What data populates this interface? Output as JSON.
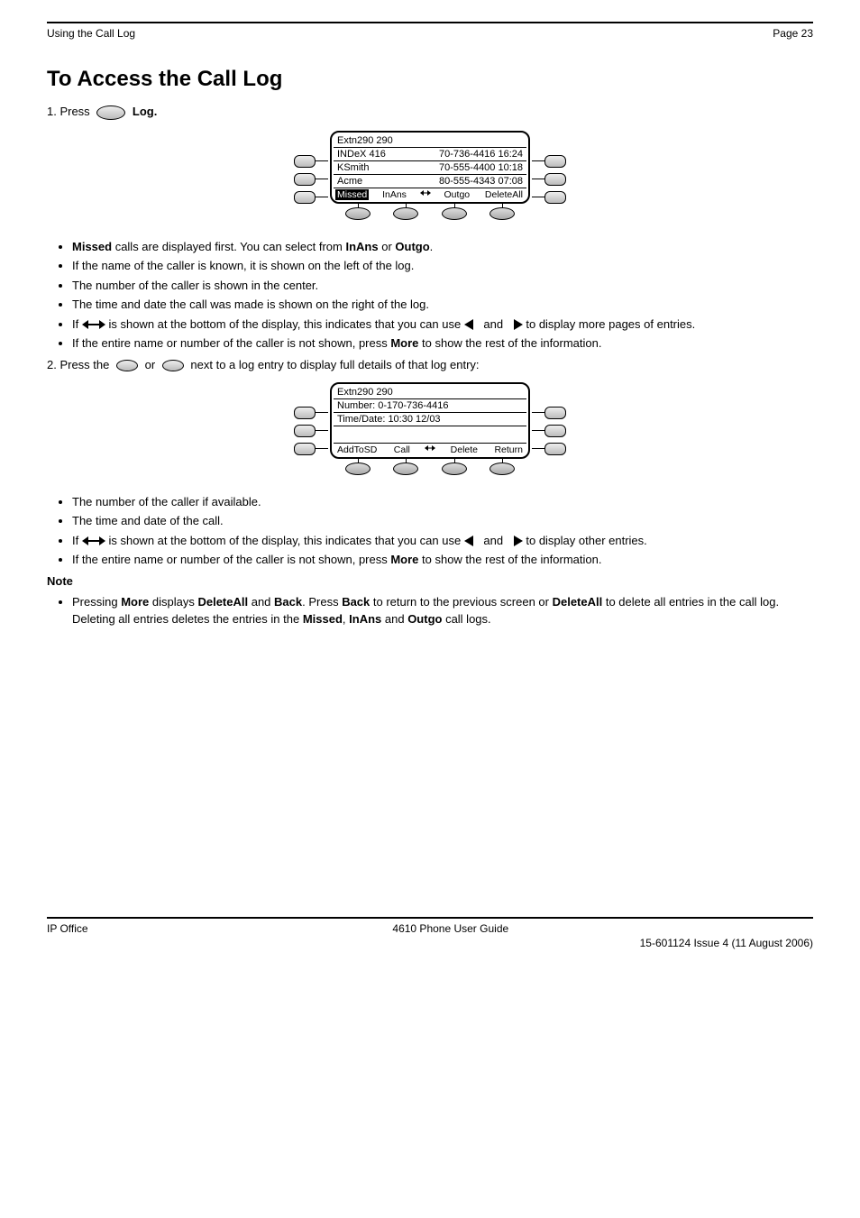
{
  "header": {
    "left": "Using the Call Log",
    "right": "Page 23"
  },
  "section_title": "To Access the Call Log",
  "step1_prefix": "1.  Press ",
  "step1_suffix": " Log.",
  "screen1": {
    "title": "Extn290 290",
    "rows": [
      {
        "left": "INDeX 416",
        "right": "70-736-4416 16:24"
      },
      {
        "left": "KSmith",
        "right": "70-555-4400 10:18"
      },
      {
        "left": "Acme",
        "right": "80-555-4343 07:08"
      }
    ],
    "softkeys": [
      "Missed",
      "InAns",
      "Outgo",
      "DeleteAll"
    ],
    "selected": 0
  },
  "bullets1": [
    {
      "text_before": "",
      "bold": "Missed",
      "text_after": " calls are displayed first. You can select from ",
      "bold2": "InAns",
      "mid2": " or ",
      "bold3": "Outgo",
      "tail": "."
    },
    {
      "text_before": "If the name of the caller is known, it is shown on the left of the log.",
      "bold": "",
      "text_after": "",
      "bold2": "",
      "mid2": "",
      "bold3": "",
      "tail": ""
    },
    {
      "text_before": "The number of the caller is shown in the center.",
      "bold": "",
      "text_after": "",
      "bold2": "",
      "mid2": "",
      "bold3": "",
      "tail": ""
    },
    {
      "text_before": "The time and date the call was made is shown on the right of the log.",
      "bold": "",
      "text_after": "",
      "bold2": "",
      "mid2": "",
      "bold3": "",
      "tail": ""
    }
  ],
  "arrow_line": {
    "prefix": "If ",
    "mid1": " is shown at the bottom of the display, this indicates that you can use ",
    "mid2": " and ",
    "suffix": " to display more pages of entries."
  },
  "bullets1b": [
    {
      "prefix": "If the entire name or number of the caller is not shown, press ",
      "bold": "More",
      "suffix": " to show the rest of the information."
    }
  ],
  "step2_prefix": "2.  Press the ",
  "step2_mid": " or ",
  "step2_suffix": " next to a log entry to display full details of that log entry:",
  "screen2": {
    "title": "Extn290 290",
    "rows": [
      {
        "left": "Number: 0-170-736-4416",
        "right": ""
      },
      {
        "left": "Time/Date: 10:30 12/03",
        "right": ""
      }
    ],
    "softkeys": [
      "AddToSD",
      "Call",
      "Delete",
      "Return"
    ]
  },
  "bullets2": [
    {
      "text": "The number of the caller if available."
    },
    {
      "text": "The time and date of the call."
    }
  ],
  "bullets2c": [
    {
      "prefix": "If ",
      "mid1": " is shown at the bottom of the display, this indicates that you can use ",
      "mid2": " and ",
      "suffix": " to display other entries."
    },
    {
      "prefix": "If the entire name or number of the caller is not shown, press ",
      "bold": "More",
      "suffix": " to show the rest of the information."
    }
  ],
  "note": {
    "label": "Note",
    "lead_bullet": "Deleting all entries deletes the entries in the ",
    "k1": "Missed",
    "sep1": ", ",
    "k2": "InAns",
    "sep2": " and ",
    "k3": "Outgo",
    "tail": " call logs.",
    "pressing": "Pressing ",
    "morekey": "More",
    "more_mid": " displays ",
    "delall": "DeleteAll",
    "and": " and ",
    "back": "Back",
    "line2b": ". Press ",
    "back2": "Back",
    "line2c": " to return to the previous screen or ",
    "delall2": "DeleteAll",
    "line2d": " to delete all entries in the",
    "line3": "call log."
  },
  "footer": {
    "left": "IP Office",
    "center": "4610 Phone User Guide",
    "right": "15-601124 Issue 4 (11 August 2006)"
  }
}
